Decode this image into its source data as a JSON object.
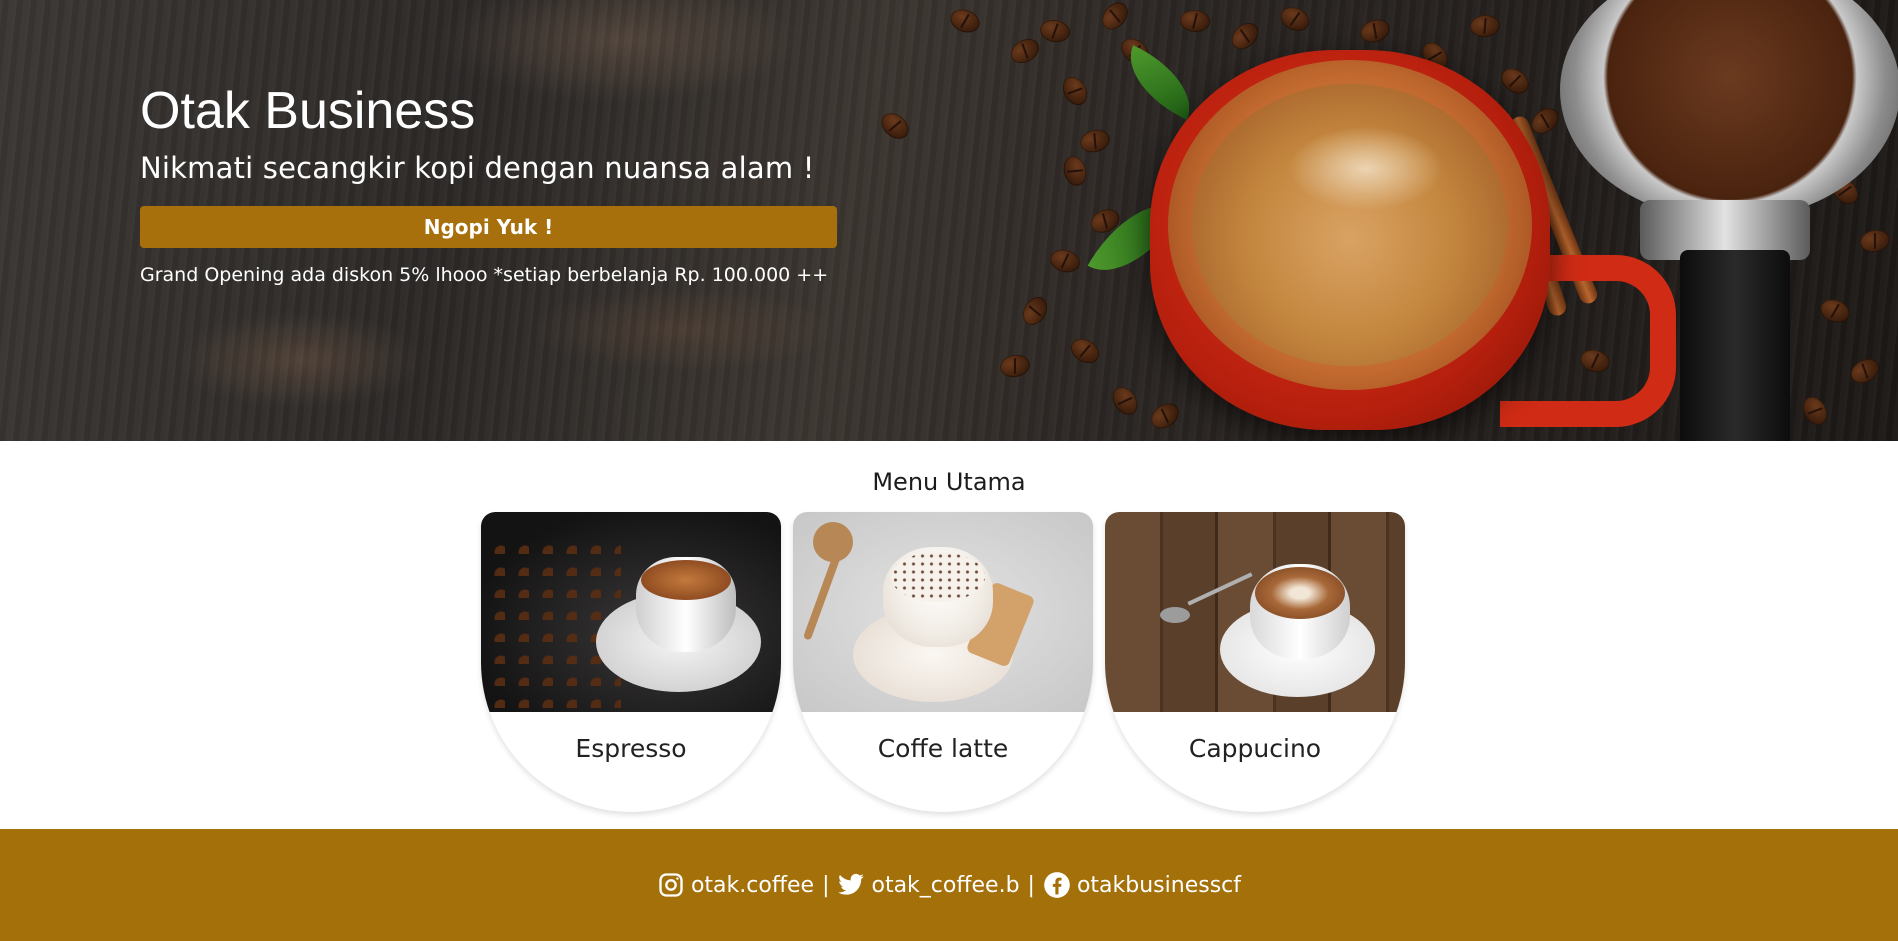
{
  "hero": {
    "title": "Otak Business",
    "subtitle": "Nikmati secangkir kopi dengan nuansa alam !",
    "cta_label": "Ngopi Yuk !",
    "promo": "Grand Opening ada diskon 5% lhooo *setiap berbelanja Rp. 100.000 ++"
  },
  "menu": {
    "title": "Menu Utama",
    "items": [
      {
        "name": "Espresso"
      },
      {
        "name": "Coffe latte"
      },
      {
        "name": "Cappucino"
      }
    ]
  },
  "footer": {
    "instagram": "otak.coffee",
    "twitter": "otak_coffee.b",
    "facebook": "otakbusinesscf",
    "separator": "|"
  },
  "colors": {
    "accent": "#a8700c",
    "footer_bg": "#a3700a"
  },
  "icons": [
    "instagram-icon",
    "twitter-icon",
    "facebook-icon"
  ]
}
